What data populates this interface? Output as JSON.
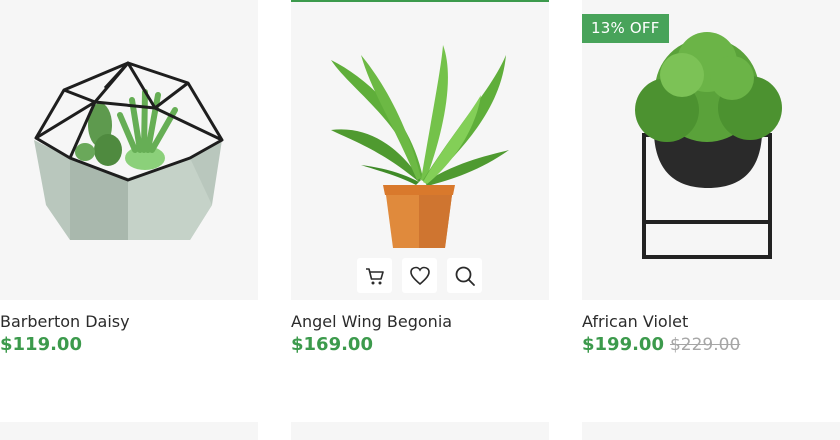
{
  "products": [
    {
      "name": "Barberton Daisy",
      "price": "$119.00"
    },
    {
      "name": "Angel Wing Begonia",
      "price": "$169.00"
    },
    {
      "name": "African Violet",
      "price": "$199.00",
      "old_price": "$229.00",
      "badge": "13% OFF"
    }
  ],
  "hover_actions": [
    "cart-icon",
    "heart-icon",
    "search-icon"
  ],
  "colors": {
    "accent": "#3c9a4c",
    "badge_bg": "#48a35a",
    "card_bg": "#f6f6f6",
    "muted": "#a6a6a6"
  }
}
